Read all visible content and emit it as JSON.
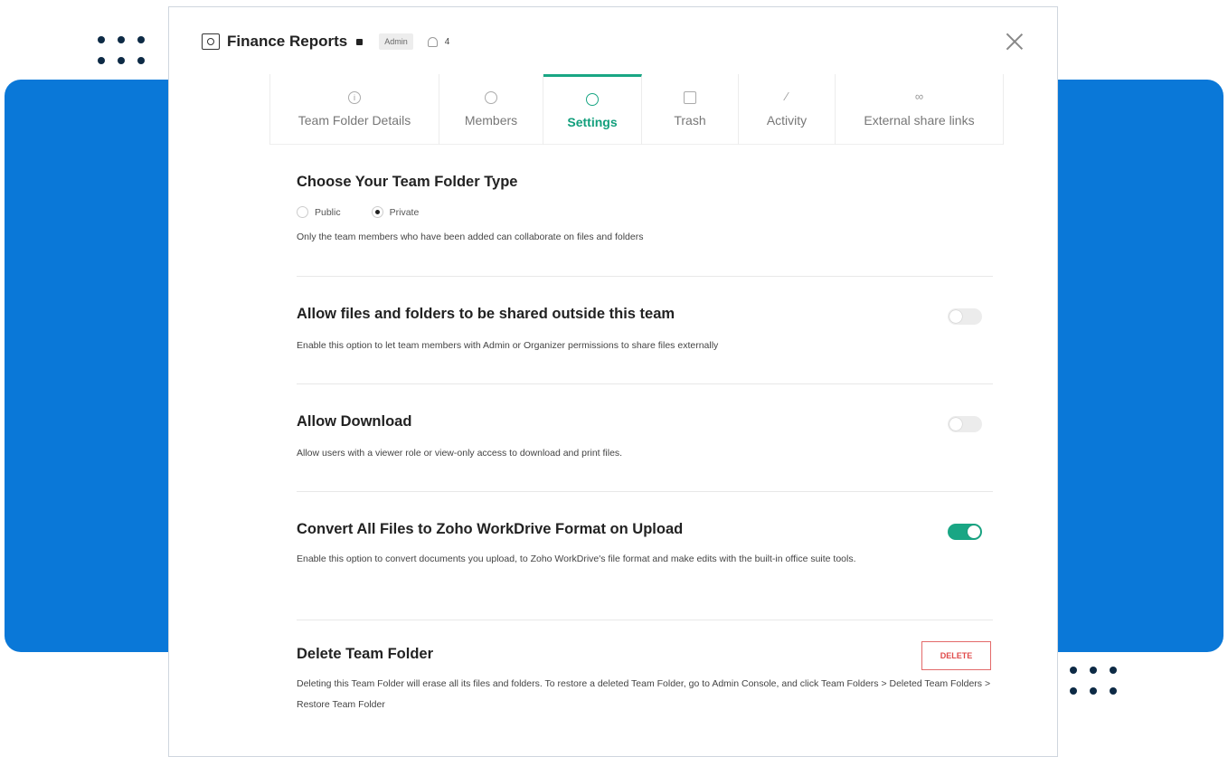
{
  "header": {
    "title": "Finance Reports",
    "role_badge": "Admin",
    "member_count": "4"
  },
  "tabs": [
    {
      "label": "Team Folder Details",
      "icon": "info-icon",
      "glyph": "i",
      "active": false
    },
    {
      "label": "Members",
      "icon": "members-icon",
      "glyph": "",
      "active": false
    },
    {
      "label": "Settings",
      "icon": "settings-icon",
      "glyph": "",
      "active": true
    },
    {
      "label": "Trash",
      "icon": "trash-icon",
      "glyph": "",
      "active": false
    },
    {
      "label": "Activity",
      "icon": "activity-icon",
      "glyph": "⁄",
      "active": false
    },
    {
      "label": "External share links",
      "icon": "link-icon",
      "glyph": "∞",
      "active": false
    }
  ],
  "settings": {
    "folder_type": {
      "title": "Choose Your Team Folder Type",
      "options": [
        "Public",
        "Private"
      ],
      "selected": "Private",
      "description": "Only the team members who have been added can collaborate on files and folders"
    },
    "share_outside": {
      "title": "Allow files and folders to be shared outside this team",
      "description": "Enable this option to let team members with Admin or Organizer permissions to share files externally",
      "enabled": false
    },
    "allow_download": {
      "title": "Allow Download",
      "description": "Allow users with a viewer role or view-only access to download and print files.",
      "enabled": false
    },
    "convert_files": {
      "title": "Convert All Files to Zoho WorkDrive Format on Upload",
      "description": "Enable this option to convert documents you upload, to Zoho WorkDrive's file format and make edits with the built-in office suite tools.",
      "enabled": true
    },
    "delete_folder": {
      "title": "Delete Team Folder",
      "button_label": "DELETE",
      "description": "Deleting this Team Folder will erase all its files and folders. To restore a deleted Team Folder, go to Admin Console, and click Team Folders > Deleted Team Folders > Restore Team Folder"
    }
  },
  "colors": {
    "accent": "#19a684",
    "background_blue": "#0a78d8",
    "danger": "#e04b4b"
  }
}
